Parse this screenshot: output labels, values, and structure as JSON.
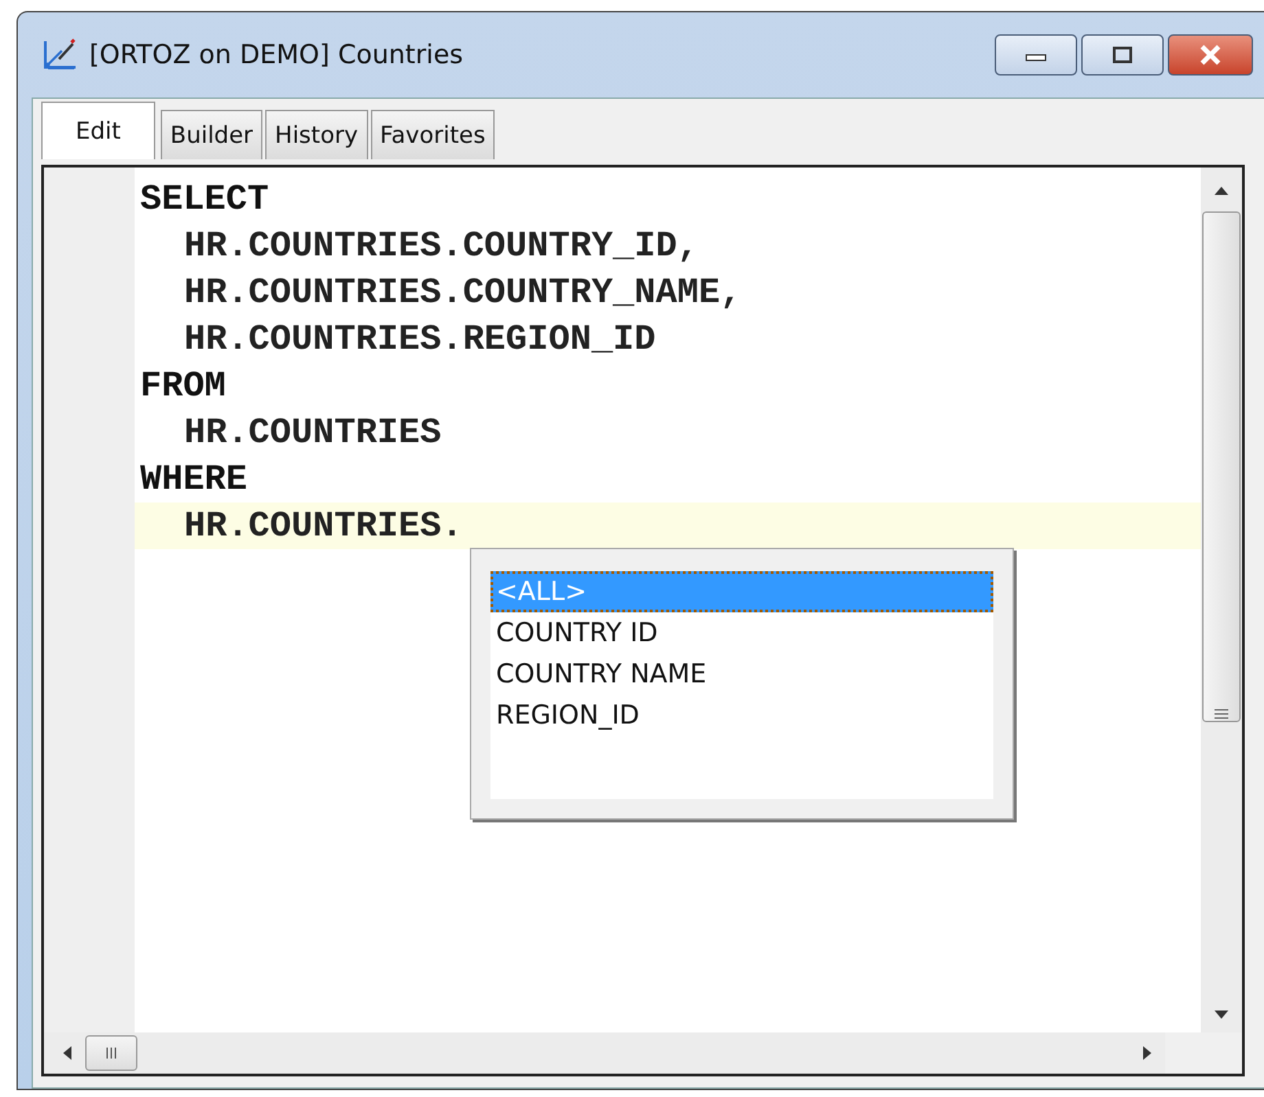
{
  "window": {
    "title": "[ORTOZ on DEMO] Countries"
  },
  "tabs": [
    {
      "label": "Edit",
      "selected": true
    },
    {
      "label": "Builder",
      "selected": false
    },
    {
      "label": "History",
      "selected": false
    },
    {
      "label": "Favorites",
      "selected": false
    }
  ],
  "editor": {
    "lines": [
      {
        "text": "SELECT",
        "kind": "keyword",
        "current": false
      },
      {
        "text": "HR.COUNTRIES.COUNTRY_ID,",
        "kind": "item",
        "current": false
      },
      {
        "text": "HR.COUNTRIES.COUNTRY_NAME,",
        "kind": "item",
        "current": false
      },
      {
        "text": "HR.COUNTRIES.REGION_ID",
        "kind": "item",
        "current": false
      },
      {
        "text": "FROM",
        "kind": "keyword",
        "current": false
      },
      {
        "text": "HR.COUNTRIES",
        "kind": "item",
        "current": false
      },
      {
        "text": "WHERE",
        "kind": "keyword",
        "current": false
      },
      {
        "text": "HR.COUNTRIES.",
        "kind": "item",
        "current": true
      }
    ]
  },
  "completion": {
    "items": [
      {
        "label": "<ALL>",
        "selected": true
      },
      {
        "label": "COUNTRY ID",
        "selected": false
      },
      {
        "label": "COUNTRY NAME",
        "selected": false
      },
      {
        "label": "REGION_ID",
        "selected": false
      }
    ]
  }
}
